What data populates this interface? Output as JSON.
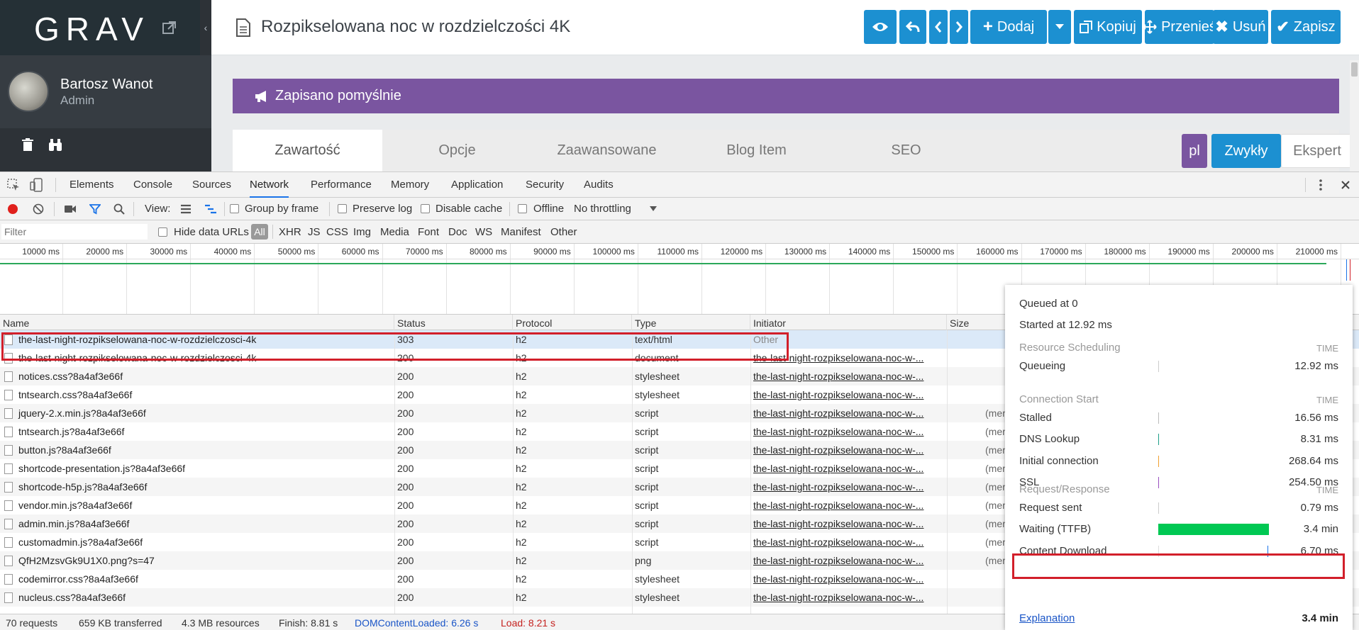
{
  "grav": {
    "logo": "GRAV",
    "user": {
      "name": "Bartosz Wanot",
      "role": "Admin"
    },
    "page_title": "Rozpikselowana noc w rozdzielczości 4K",
    "toolbar": {
      "add_label": "Dodaj",
      "copy_label": "Kopiuj",
      "move_label": "Przenieś",
      "delete_label": "Usuń",
      "save_label": "Zapisz"
    },
    "flash_message": "Zapisano pomyślnie",
    "tabs": [
      "Zawartość",
      "Opcje",
      "Zaawansowane",
      "Blog Item",
      "SEO"
    ],
    "language": "pl",
    "modes": {
      "normal": "Zwykły",
      "expert": "Ekspert"
    },
    "colors": {
      "accent": "#1c90d1",
      "purple": "#7a55a0",
      "sidebar": "#2d3237"
    }
  },
  "devtools": {
    "tabs": [
      "Elements",
      "Console",
      "Sources",
      "Network",
      "Performance",
      "Memory",
      "Application",
      "Security",
      "Audits"
    ],
    "active_tab": "Network",
    "toolbar": {
      "view_label": "View:",
      "group_by_frame": "Group by frame",
      "preserve_log": "Preserve log",
      "disable_cache": "Disable cache",
      "offline": "Offline",
      "throttling": "No throttling"
    },
    "filter": {
      "placeholder": "Filter",
      "hide_data_urls": "Hide data URLs",
      "types": [
        "All",
        "XHR",
        "JS",
        "CSS",
        "Img",
        "Media",
        "Font",
        "Doc",
        "WS",
        "Manifest",
        "Other"
      ]
    },
    "timeline_ticks": [
      "10000 ms",
      "20000 ms",
      "30000 ms",
      "40000 ms",
      "50000 ms",
      "60000 ms",
      "70000 ms",
      "80000 ms",
      "90000 ms",
      "100000 ms",
      "110000 ms",
      "120000 ms",
      "130000 ms",
      "140000 ms",
      "150000 ms",
      "160000 ms",
      "170000 ms",
      "180000 ms",
      "190000 ms",
      "200000 ms",
      "210000 ms"
    ],
    "columns": [
      "Name",
      "Status",
      "Protocol",
      "Type",
      "Initiator",
      "Size"
    ],
    "rows": [
      {
        "name": "the-last-night-rozpikselowana-noc-w-rozdzielczosci-4k",
        "status": "303",
        "protocol": "h2",
        "type": "text/html",
        "initiator": "Other",
        "size": ""
      },
      {
        "name": "the-last-night-rozpikselowana-noc-w-rozdzielczosci-4k",
        "status": "200",
        "protocol": "h2",
        "type": "document",
        "initiator": "the-last-night-rozpikselowana-noc-w-...",
        "size": ""
      },
      {
        "name": "notices.css?8a4af3e66f",
        "status": "200",
        "protocol": "h2",
        "type": "stylesheet",
        "initiator": "the-last-night-rozpikselowana-noc-w-...",
        "size": ""
      },
      {
        "name": "tntsearch.css?8a4af3e66f",
        "status": "200",
        "protocol": "h2",
        "type": "stylesheet",
        "initiator": "the-last-night-rozpikselowana-noc-w-...",
        "size": ""
      },
      {
        "name": "jquery-2.x.min.js?8a4af3e66f",
        "status": "200",
        "protocol": "h2",
        "type": "script",
        "initiator": "the-last-night-rozpikselowana-noc-w-...",
        "size": "(mer"
      },
      {
        "name": "tntsearch.js?8a4af3e66f",
        "status": "200",
        "protocol": "h2",
        "type": "script",
        "initiator": "the-last-night-rozpikselowana-noc-w-...",
        "size": "(mer"
      },
      {
        "name": "button.js?8a4af3e66f",
        "status": "200",
        "protocol": "h2",
        "type": "script",
        "initiator": "the-last-night-rozpikselowana-noc-w-...",
        "size": "(mer"
      },
      {
        "name": "shortcode-presentation.js?8a4af3e66f",
        "status": "200",
        "protocol": "h2",
        "type": "script",
        "initiator": "the-last-night-rozpikselowana-noc-w-...",
        "size": "(mer"
      },
      {
        "name": "shortcode-h5p.js?8a4af3e66f",
        "status": "200",
        "protocol": "h2",
        "type": "script",
        "initiator": "the-last-night-rozpikselowana-noc-w-...",
        "size": "(mer"
      },
      {
        "name": "vendor.min.js?8a4af3e66f",
        "status": "200",
        "protocol": "h2",
        "type": "script",
        "initiator": "the-last-night-rozpikselowana-noc-w-...",
        "size": "(mer"
      },
      {
        "name": "admin.min.js?8a4af3e66f",
        "status": "200",
        "protocol": "h2",
        "type": "script",
        "initiator": "the-last-night-rozpikselowana-noc-w-...",
        "size": "(mer"
      },
      {
        "name": "customadmin.js?8a4af3e66f",
        "status": "200",
        "protocol": "h2",
        "type": "script",
        "initiator": "the-last-night-rozpikselowana-noc-w-...",
        "size": "(mer"
      },
      {
        "name": "QfH2MzsvGk9U1X0.png?s=47",
        "status": "200",
        "protocol": "h2",
        "type": "png",
        "initiator": "the-last-night-rozpikselowana-noc-w-...",
        "size": "(mer"
      },
      {
        "name": "codemirror.css?8a4af3e66f",
        "status": "200",
        "protocol": "h2",
        "type": "stylesheet",
        "initiator": "the-last-night-rozpikselowana-noc-w-...",
        "size": ""
      },
      {
        "name": "nucleus.css?8a4af3e66f",
        "status": "200",
        "protocol": "h2",
        "type": "stylesheet",
        "initiator": "the-last-night-rozpikselowana-noc-w-...",
        "size": ""
      }
    ],
    "status_bar": {
      "requests": "70 requests",
      "transferred": "659 KB transferred",
      "resources": "4.3 MB resources",
      "finish": "Finish: 8.81 s",
      "dom_content_loaded": "DOMContentLoaded: 6.26 s",
      "load": "Load: 8.21 s"
    },
    "timing": {
      "queued_at": "Queued at 0",
      "started_at": "Started at 12.92 ms",
      "time_header": "TIME",
      "sections": [
        {
          "title": "Resource Scheduling",
          "items": [
            {
              "label": "Queueing",
              "value": "12.92 ms",
              "color": "#cccccc"
            }
          ]
        },
        {
          "title": "Connection Start",
          "items": [
            {
              "label": "Stalled",
              "value": "16.56 ms",
              "color": "#bbbbbb"
            },
            {
              "label": "DNS Lookup",
              "value": "8.31 ms",
              "color": "#1f9e89"
            },
            {
              "label": "Initial connection",
              "value": "268.64 ms",
              "color": "#f0a030"
            },
            {
              "label": "SSL",
              "value": "254.50 ms",
              "color": "#9a4fc0"
            }
          ]
        },
        {
          "title": "Request/Response",
          "items": [
            {
              "label": "Request sent",
              "value": "0.79 ms",
              "color": "#cccccc"
            },
            {
              "label": "Waiting (TTFB)",
              "value": "3.4 min",
              "color": "#00c853"
            },
            {
              "label": "Content Download",
              "value": "6.70 ms",
              "color": "#1a73e8"
            }
          ]
        }
      ],
      "explanation": "Explanation",
      "total": "3.4 min"
    }
  }
}
